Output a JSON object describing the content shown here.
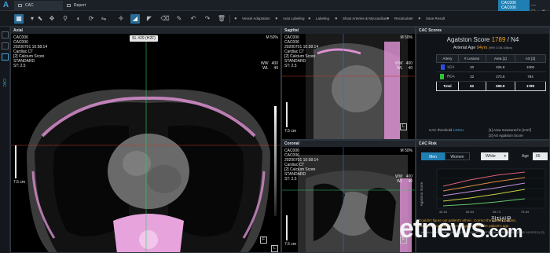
{
  "app": {
    "tabs": [
      {
        "label": "CAC"
      },
      {
        "label": "Report"
      }
    ],
    "patient_badge": [
      "CAC006",
      "CAC006"
    ],
    "window_buttons": "— ▢ ✕"
  },
  "toolbar": {
    "labels": {
      "vessel_adaptation": "Vessel Adaptation",
      "auto_labeling": "Auto Labeling",
      "labeling": "Labeling",
      "show_arteries": "Show Arteries & Myocardium",
      "recalculate": "Recalculate",
      "save_result": "Save Result"
    }
  },
  "rail": {
    "vertical_label": "CAC"
  },
  "viewports": {
    "axial": {
      "title": "Axial",
      "patient_id": "CAC006",
      "patient_name": "CAC006",
      "datetime": "20200701 10:58:14",
      "modality": "Cardiac CT",
      "series": "[2] Calcium Score",
      "kernel": "STANDARD",
      "thickness": "ST: 2.5",
      "zoom": "M 50%",
      "ww": "WW   400",
      "wl": "WL     40",
      "scale_label": "7.5 cm",
      "slice_tip": "SL #29 (H2F)",
      "orient_right": "F",
      "orient_left": "L"
    },
    "sagittal": {
      "title": "Sagittal",
      "patient_id": "CAC006",
      "patient_name": "CAC006",
      "datetime": "20200701 10:58:14",
      "modality": "Cardiac CT",
      "series": "[2] Calcium Score",
      "kernel": "STANDARD",
      "thickness": "ST: 2.5",
      "zoom": "M 50%",
      "ww": "WW   400",
      "wl": "WL     40",
      "scale_label": "7.5 cm",
      "orient": "L"
    },
    "coronal": {
      "title": "Coronal",
      "patient_id": "CAC006",
      "patient_name": "CAC006",
      "datetime": "20200701 10:58:14",
      "modality": "Cardiac CT",
      "series": "[2] Calcium Score",
      "kernel": "STANDARD",
      "thickness": "ST: 2.5",
      "zoom": "M 50%",
      "ww": "WW   400",
      "wl": "WL     40",
      "scale_label": "7.5 cm",
      "orient": "F"
    }
  },
  "cac_scores": {
    "title": "CAC Scores",
    "agatston_label": "Agatston Score",
    "agatston_value": "1789",
    "agatston_suffix": "/ N4",
    "arterial_label": "Arterial Age",
    "arterial_value": "94yrs",
    "arterial_ci": "(95% CI 88-108yrs)",
    "columns": [
      "Artery",
      "# Lesions",
      "Area [1]",
      "AS [2]"
    ],
    "rows": [
      {
        "artery": "LCA",
        "lesions": "30",
        "area": "326.8",
        "as": "1005",
        "color": "#2a4fe0"
      },
      {
        "artery": "RCA",
        "lesions": "32",
        "area": "273.5",
        "as": "784",
        "color": "#2fc23a"
      },
      {
        "artery": "Total",
        "lesions": "62",
        "area": "599.9",
        "as": "1789",
        "color": ""
      }
    ],
    "threshold_label": "CAC threshold",
    "threshold_value": "130HU",
    "note1": "[1] Area measured in [mm²]",
    "note2": "[2] AS Agatston Score"
  },
  "cac_risk": {
    "title": "CAC Risk",
    "sex_options": [
      "Men",
      "Women"
    ],
    "ethnicity": "White",
    "age_label": "Age",
    "age_value": "65",
    "y_label": "Agatston Score",
    "x_ticks": [
      "45-54",
      "55-64",
      "65-74",
      "75-84"
    ],
    "warning1": "Couldn't figure out patient's ethnic. Correct the patient's ethnic.",
    "warning2": "Couldn't figure out patient's age. Correct the patient's age.",
    "citation": "Circulation. 2006; https://doi.org/10.1161/CIRCULATIONAHA.105.580696 (PMID 16432311) [3]"
  },
  "watermark": {
    "text": "etnews",
    "suffix": ".com",
    "ko": "전자신문"
  }
}
